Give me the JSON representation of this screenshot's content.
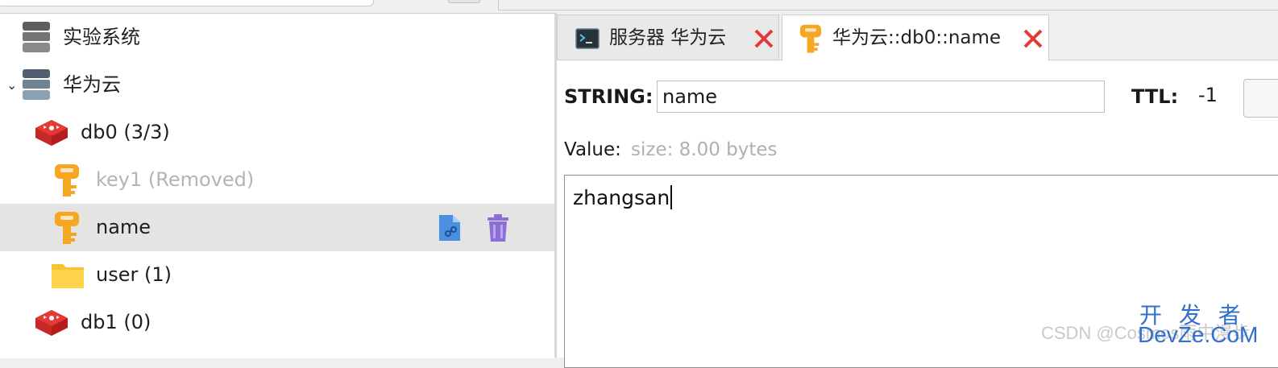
{
  "tree": {
    "items": [
      {
        "label": "实验系统",
        "icon": "server-icon"
      },
      {
        "label": "华为云",
        "icon": "server-icon",
        "expanded": true
      },
      {
        "label": "db0  (3/3)",
        "icon": "redis-db-icon"
      },
      {
        "label": "key1 (Removed)",
        "icon": "key-icon",
        "removed": true
      },
      {
        "label": "name",
        "icon": "key-icon",
        "selected": true,
        "actions": [
          "copy-file-icon",
          "trash-icon"
        ]
      },
      {
        "label": "user (1)",
        "icon": "folder-icon"
      },
      {
        "label": "db1 (0)",
        "icon": "redis-db-icon"
      }
    ]
  },
  "tabs": [
    {
      "label": "服务器 华为云",
      "icon": "terminal-icon",
      "active": false
    },
    {
      "label": "华为云::db0::name",
      "icon": "key-icon",
      "active": true
    }
  ],
  "editor": {
    "type_label": "STRING:",
    "key_name": "name",
    "ttl_label": "TTL:",
    "ttl_value": "-1",
    "value_label": "Value:",
    "size_hint": "size: 8.00 bytes",
    "value": "zhangsan"
  },
  "watermark": {
    "csdn": "CSDN @Cosmos雨中漫步",
    "devze_cn": "开 发 者",
    "devze_en": "DevZe.CoM"
  },
  "colors": {
    "selection": "#e4e4e4",
    "close_red": "#e53935",
    "redis_red": "#d32f2f",
    "key_orange": "#f5a623",
    "folder_yellow": "#f7c333",
    "trash_purple": "#8c6fd6"
  }
}
